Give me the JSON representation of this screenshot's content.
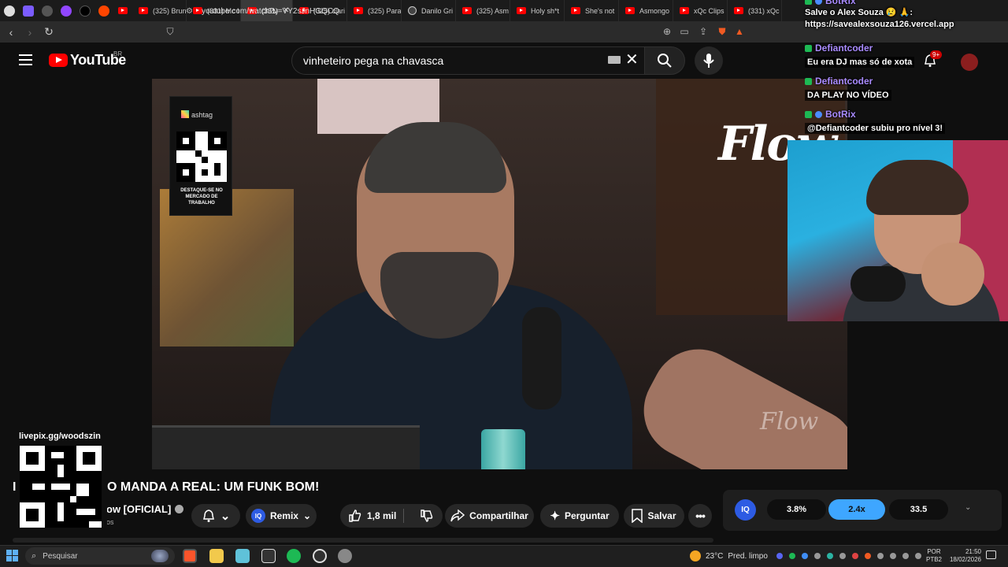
{
  "browser": {
    "tabs": [
      {
        "label": "(325) Brun"
      },
      {
        "label": "(331) Mc I"
      },
      {
        "label": "(331)",
        "active": true
      },
      {
        "label": "(325) clari"
      },
      {
        "label": "(325) Para"
      },
      {
        "label": "Danilo Gri"
      },
      {
        "label": "(325) Asm"
      },
      {
        "label": "Holy sh*t"
      },
      {
        "label": "She's not"
      },
      {
        "label": "Asmongo"
      },
      {
        "label": "xQc Clips"
      },
      {
        "label": "(331) xQc"
      }
    ],
    "url": "youtube.com/watch?v=VY2sJnHGQCQ"
  },
  "youtube": {
    "logo_text": "YouTube",
    "country": "BR",
    "search_query": "vinheteiro pega na chavasca",
    "notification_count": "9+"
  },
  "video_overlay": {
    "ad_brand": "ashtag",
    "ad_text": "DESTAQUE-SE NO MERCADO DE TRABALHO",
    "flow_logo": "Flow",
    "flow_watermark": "Flow"
  },
  "chat": [
    {
      "user": "BotRix",
      "text": "Salve o Alex Souza 😢 🙏:"
    },
    {
      "user": "",
      "text": "https://savealexsouza126.vercel.app"
    },
    {
      "user": "Defiantcoder",
      "text": "Eu era DJ mas só de xota"
    },
    {
      "user": "Defiantcoder",
      "text": "DA PLAY NO VÍDEO"
    },
    {
      "user": "BotRix",
      "text": "@Defiantcoder subiu pro nível 3!"
    }
  ],
  "video": {
    "title": "RO MANDA A REAL: UM FUNK BOM!",
    "title_prefix": "I",
    "channel": "ow [OFICIAL]",
    "subs": "os"
  },
  "actions": {
    "remix": "Remix",
    "likes": "1,8 mil",
    "share": "Compartilhar",
    "ask": "Perguntar",
    "save": "Salvar"
  },
  "speed": {
    "badge": "IQ",
    "options": [
      "3.8%",
      "2.4x",
      "33.5"
    ],
    "active_index": 1
  },
  "livepix": {
    "url": "livepix.gg/woodszin"
  },
  "taskbar": {
    "search_placeholder": "Pesquisar",
    "weather": "23°C",
    "weather_desc": "Pred. limpo",
    "lang_1": "POR",
    "lang_2": "PTB2",
    "time": "21:50",
    "date": "18/02/2026"
  },
  "colors": {
    "youtube_red": "#ff0000",
    "accent_blue": "#3ea6ff",
    "chat_name": "#a98bff"
  }
}
